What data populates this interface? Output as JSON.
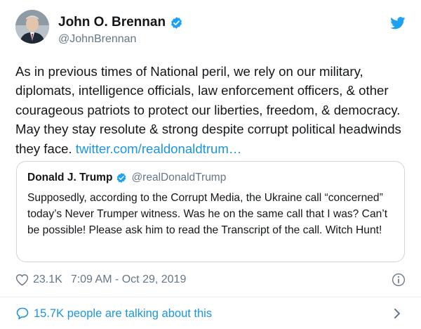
{
  "author": {
    "name": "John O. Brennan",
    "handle": "@JohnBrennan",
    "verified_icon": "verified-badge-icon",
    "avatar": "avatar"
  },
  "tweet": {
    "text": "As in previous times of National peril, we rely on our military, diplomats, intelligence officials, law enforcement officers, & other courageous patriots to protect our liberties, freedom, & democracy. May they stay resolute & strong despite corrupt political headwinds they face. ",
    "link": "twitter.com/realdonaldtrum…"
  },
  "quoted_tweet": {
    "name": "Donald J. Trump",
    "handle": "@realDonaldTrump",
    "text": "Supposedly, according to the Corrupt Media, the Ukraine call “concerned” today’s Never Trumper witness. Was he on the same call that I was? Can’t be possible! Please ask him to read the Transcript of the call. Witch Hunt!"
  },
  "meta": {
    "likes": "23.1K",
    "timestamp": "7:09 AM - Oct 29, 2019"
  },
  "footer": {
    "talking": "15.7K people are talking about this"
  },
  "colors": {
    "accent": "#1b95e0",
    "verified": "#1da1f2",
    "secondary_text": "#657786",
    "border": "#ccd6dd"
  },
  "icons": [
    "twitter-bird-icon",
    "verified-badge-icon",
    "heart-icon",
    "info-icon",
    "speech-bubble-icon",
    "chevron-right-icon"
  ]
}
